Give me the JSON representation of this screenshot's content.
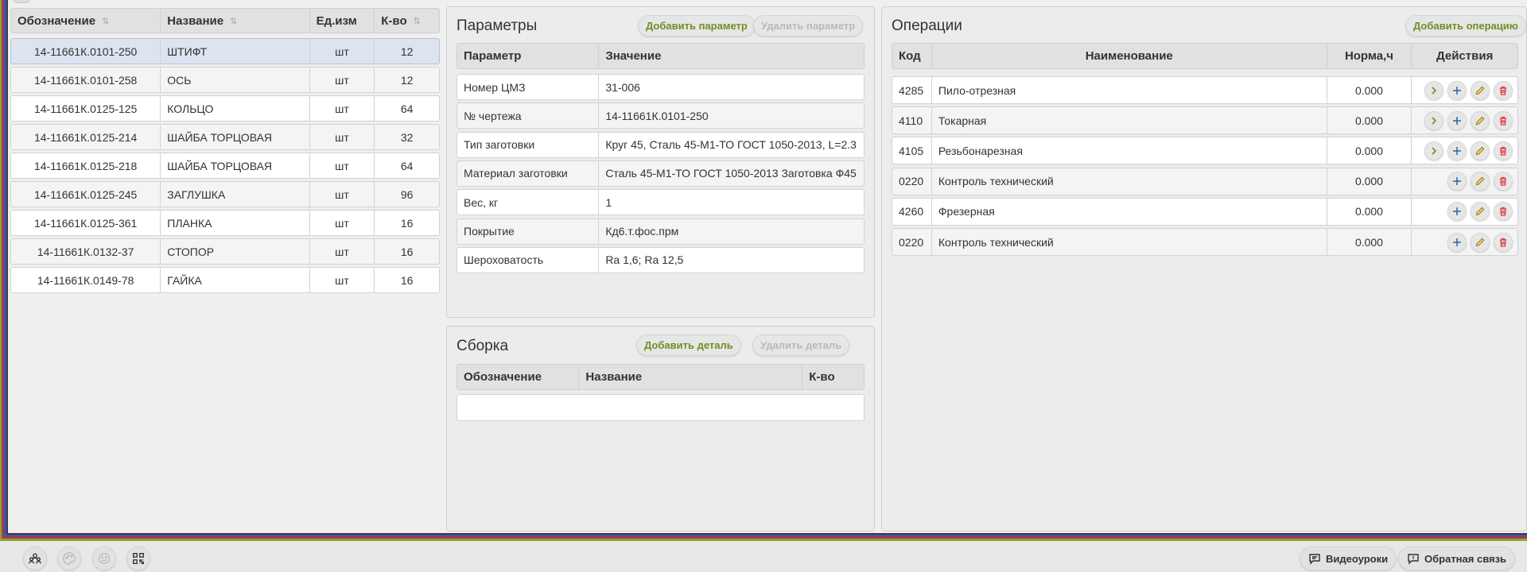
{
  "items_table": {
    "headers": {
      "code": "Обозначение",
      "name": "Название",
      "unit": "Ед.изм",
      "qty": "К-во"
    },
    "rows": [
      {
        "code": "14-11661К.0101-250",
        "name": "ШТИФТ",
        "unit": "шт",
        "qty": "12"
      },
      {
        "code": "14-11661К.0101-258",
        "name": "ОСЬ",
        "unit": "шт",
        "qty": "12"
      },
      {
        "code": "14-11661К.0125-125",
        "name": "КОЛЬЦО",
        "unit": "шт",
        "qty": "64"
      },
      {
        "code": "14-11661К.0125-214",
        "name": "ШАЙБА ТОРЦОВАЯ",
        "unit": "шт",
        "qty": "32"
      },
      {
        "code": "14-11661К.0125-218",
        "name": "ШАЙБА ТОРЦОВАЯ",
        "unit": "шт",
        "qty": "64"
      },
      {
        "code": "14-11661К.0125-245",
        "name": "ЗАГЛУШКА",
        "unit": "шт",
        "qty": "96"
      },
      {
        "code": "14-11661К.0125-361",
        "name": "ПЛАНКА",
        "unit": "шт",
        "qty": "16"
      },
      {
        "code": "14-11661К.0132-37",
        "name": "СТОПОР",
        "unit": "шт",
        "qty": "16"
      },
      {
        "code": "14-11661К.0149-78",
        "name": "ГАЙКА",
        "unit": "шт",
        "qty": "16"
      }
    ]
  },
  "parameters": {
    "title": "Параметры",
    "add_label": "Добавить параметр",
    "delete_label": "Удалить параметр",
    "headers": {
      "param": "Параметр",
      "value": "Значение"
    },
    "rows": [
      {
        "param": "Номер ЦМЗ",
        "value": "31-006"
      },
      {
        "param": "№ чертежа",
        "value": "14-11661К.0101-250"
      },
      {
        "param": "Тип заготовки",
        "value": "Круг 45, Сталь 45-М1-ТО ГОСТ 1050-2013, L=2.3"
      },
      {
        "param": "Материал заготовки",
        "value": "Сталь 45-М1-ТО ГОСТ 1050-2013 Заготовка Ф45"
      },
      {
        "param": "Вес, кг",
        "value": "1"
      },
      {
        "param": "Покрытие",
        "value": "Кд6.т.фос.прм"
      },
      {
        "param": "Шероховатость",
        "value": "Ra 1,6; Ra 12,5"
      }
    ]
  },
  "assembly": {
    "title": "Сборка",
    "add_label": "Добавить деталь",
    "delete_label": "Удалить деталь",
    "headers": {
      "code": "Обозначение",
      "name": "Название",
      "qty": "К-во"
    }
  },
  "operations": {
    "title": "Операции",
    "add_label": "Добавить операцию",
    "headers": {
      "code": "Код",
      "name": "Наименование",
      "norm": "Норма,ч",
      "actions": "Действия"
    },
    "rows": [
      {
        "code": "4285",
        "name": "Пило-отрезная",
        "norm": "0.000",
        "has_expand": true
      },
      {
        "code": "4110",
        "name": "Токарная",
        "norm": "0.000",
        "has_expand": true
      },
      {
        "code": "4105",
        "name": "Резьбонарезная",
        "norm": "0.000",
        "has_expand": true
      },
      {
        "code": "0220",
        "name": "Контроль технический",
        "norm": "0.000",
        "has_expand": false
      },
      {
        "code": "4260",
        "name": "Фрезерная",
        "norm": "0.000",
        "has_expand": false
      },
      {
        "code": "0220",
        "name": "Контроль технический",
        "norm": "0.000",
        "has_expand": false
      }
    ]
  },
  "bottom_bar": {
    "video_label": "Видеоуроки",
    "feedback_label": "Обратная связь"
  },
  "colors": {
    "accent": "#6f8f23",
    "selected_row": "#dde3ef",
    "delete_icon": "#d9363e",
    "add_icon": "#2f5fae",
    "edit_icon": "#b8860b",
    "expand_icon": "#6f8f23"
  },
  "icons": [
    "sort-icon",
    "people-icon",
    "palette-icon",
    "smile-icon",
    "qr-code-icon",
    "chat-icon",
    "feedback-icon",
    "chevron-right-icon",
    "plus-icon",
    "pencil-icon",
    "trash-icon"
  ]
}
